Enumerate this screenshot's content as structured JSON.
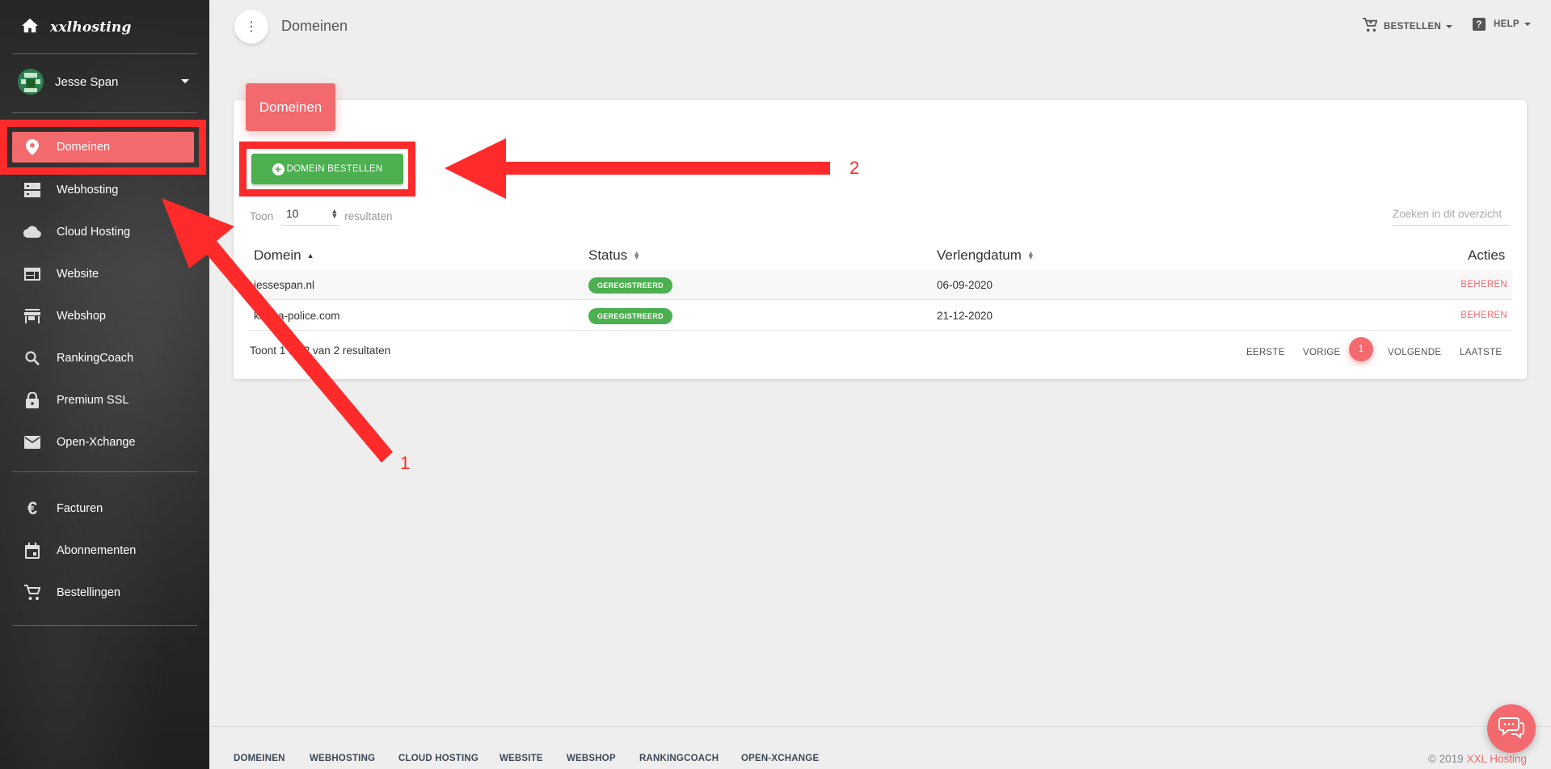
{
  "app": {
    "logo_text": "xxlhosting"
  },
  "user": {
    "name": "Jesse Span"
  },
  "sidebar": {
    "items": [
      {
        "label": "Domeinen",
        "icon": "map-pin-icon",
        "active": true
      },
      {
        "label": "Webhosting",
        "icon": "server-icon"
      },
      {
        "label": "Cloud Hosting",
        "icon": "cloud-icon"
      },
      {
        "label": "Website",
        "icon": "web-icon"
      },
      {
        "label": "Webshop",
        "icon": "store-icon"
      },
      {
        "label": "RankingCoach",
        "icon": "search-icon"
      },
      {
        "label": "Premium SSL",
        "icon": "lock-icon"
      },
      {
        "label": "Open-Xchange",
        "icon": "mail-icon"
      }
    ],
    "items2": [
      {
        "label": "Facturen",
        "icon": "euro-icon"
      },
      {
        "label": "Abonnementen",
        "icon": "calendar-icon"
      },
      {
        "label": "Bestellingen",
        "icon": "cart-icon"
      }
    ]
  },
  "topbar": {
    "title": "Domeinen",
    "order_label": "BESTELLEN",
    "help_label": "HELP"
  },
  "card": {
    "header": "Domeinen",
    "order_button": "DOMEIN BESTELLEN",
    "show_label": "Toon",
    "page_size": "10",
    "results_label": "resultaten",
    "search_placeholder": "Zoeken in dit overzicht"
  },
  "table": {
    "columns": [
      "Domein",
      "Status",
      "Verlengdatum",
      "Acties"
    ],
    "rows": [
      {
        "domain": "jessespan.nl",
        "status": "GEREGISTREERD",
        "date": "06-09-2020",
        "action": "BEHEREN"
      },
      {
        "domain": "karma-police.com",
        "status": "GEREGISTREERD",
        "date": "21-12-2020",
        "action": "BEHEREN"
      }
    ],
    "summary": "Toont 1 tot 2 van 2 resultaten"
  },
  "pagination": {
    "first": "EERSTE",
    "prev": "VORIGE",
    "current": "1",
    "next": "VOLGENDE",
    "last": "LAATSTE"
  },
  "footer": {
    "links": [
      "DOMEINEN",
      "WEBHOSTING",
      "CLOUD HOSTING",
      "WEBSITE",
      "WEBSHOP",
      "RANKINGCOACH",
      "OPEN-XCHANGE"
    ],
    "copyright_prefix": "© 2019",
    "copyright_brand": "XXL Hosting"
  },
  "annotations": {
    "arrow1_label": "1",
    "arrow2_label": "2",
    "color": "#ff2a2a"
  },
  "colors": {
    "accent": "#f26a6d",
    "success": "#4caf50",
    "sidebar_bg": "#2c2c2c"
  }
}
